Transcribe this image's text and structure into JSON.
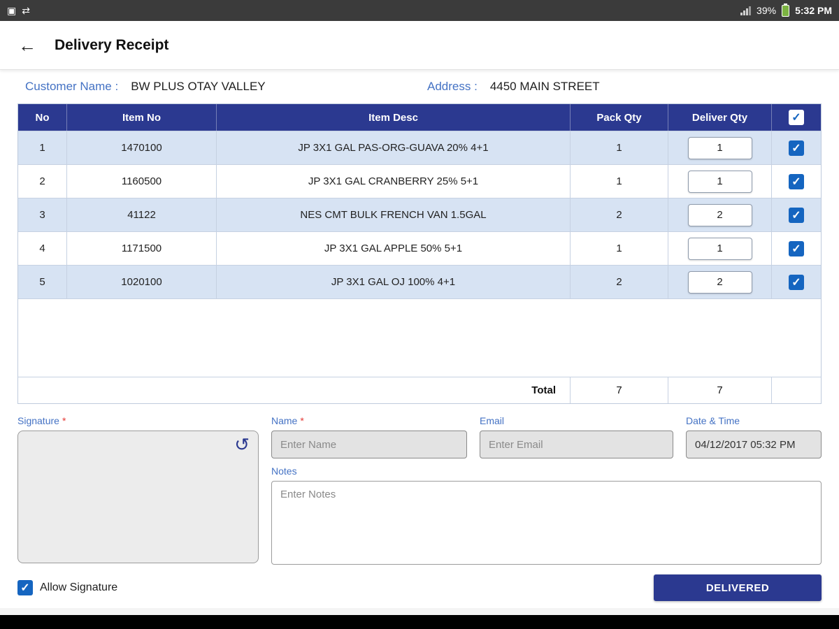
{
  "status_bar": {
    "battery_percent": "39%",
    "time": "5:32 PM"
  },
  "header": {
    "title": "Delivery Receipt"
  },
  "customer": {
    "name_label": "Customer Name :",
    "name": "BW PLUS OTAY VALLEY",
    "address_label": "Address :",
    "address": "4450 MAIN STREET"
  },
  "table": {
    "headers": {
      "no": "No",
      "item_no": "Item No",
      "item_desc": "Item Desc",
      "pack_qty": "Pack Qty",
      "deliver_qty": "Deliver Qty"
    },
    "rows": [
      {
        "no": "1",
        "item_no": "1470100",
        "item_desc": "JP 3X1 GAL PAS-ORG-GUAVA 20% 4+1",
        "pack_qty": "1",
        "deliver_qty": "1"
      },
      {
        "no": "2",
        "item_no": "1160500",
        "item_desc": "JP 3X1 GAL CRANBERRY 25% 5+1",
        "pack_qty": "1",
        "deliver_qty": "1"
      },
      {
        "no": "3",
        "item_no": "41122",
        "item_desc": "NES CMT BULK FRENCH VAN 1.5GAL",
        "pack_qty": "2",
        "deliver_qty": "2"
      },
      {
        "no": "4",
        "item_no": "1171500",
        "item_desc": "JP 3X1 GAL APPLE 50% 5+1",
        "pack_qty": "1",
        "deliver_qty": "1"
      },
      {
        "no": "5",
        "item_no": "1020100",
        "item_desc": "JP 3X1 GAL OJ 100% 4+1",
        "pack_qty": "2",
        "deliver_qty": "2"
      }
    ],
    "total_label": "Total",
    "total_pack_qty": "7",
    "total_deliver_qty": "7"
  },
  "form": {
    "signature_label": "Signature",
    "required_marker": "*",
    "name_label": "Name",
    "name_placeholder": "Enter Name",
    "email_label": "Email",
    "email_placeholder": "Enter Email",
    "datetime_label": "Date & Time",
    "datetime_value": "04/12/2017 05:32 PM",
    "notes_label": "Notes",
    "notes_placeholder": "Enter Notes",
    "allow_signature_label": "Allow Signature",
    "delivered_button_label": "DELIVERED"
  },
  "icons": {
    "check": "✓",
    "back_arrow": "←",
    "refresh": "↺",
    "photo": "▣",
    "share": "⇄"
  },
  "colors": {
    "header_blue": "#2b3990",
    "accent_blue": "#4472c4",
    "checkbox_blue": "#1565c0",
    "row_alt": "#d7e3f3"
  }
}
